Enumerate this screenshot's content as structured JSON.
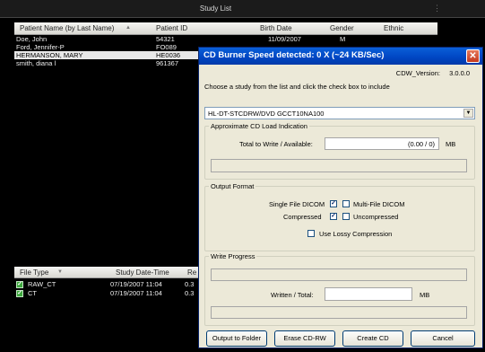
{
  "study_list": {
    "title": "Study List",
    "columns": [
      "Patient Name (by Last Name)",
      "Patient ID",
      "Birth Date",
      "Gender",
      "Ethnic"
    ],
    "rows": [
      {
        "name": "Doe, John",
        "id": "54321",
        "birth": "11/09/2007",
        "gender": "M",
        "selected": false
      },
      {
        "name": "Ford, Jennifer-P",
        "id": "FO089",
        "birth": "",
        "gender": "",
        "selected": false
      },
      {
        "name": "HERMANSON, MARY",
        "id": "HE0036",
        "birth": "",
        "gender": "",
        "selected": true
      },
      {
        "name": "smith, diana l",
        "id": "961367",
        "birth": "",
        "gender": "",
        "selected": false
      }
    ]
  },
  "file_list": {
    "columns": [
      "File Type",
      "Study Date-Time",
      "Re"
    ],
    "rows": [
      {
        "type": "RAW_CT",
        "datetime": "07/19/2007 11:04",
        "extra": "0.3",
        "checked": true
      },
      {
        "type": "CT",
        "datetime": "07/19/2007 11:04",
        "extra": "0.3",
        "checked": true
      }
    ]
  },
  "dialog": {
    "title": "CD Burner Speed detected: 0 X (~24 KB/Sec)",
    "version_label": "CDW_Version:",
    "version_value": "3.0.0.0",
    "instruction": "Choose a study from the list and click the check box to include",
    "drive": "HL-DT-STCDRW/DVD GCCT10NA100",
    "load": {
      "legend": "Approximate CD Load Indication",
      "label": "Total to Write / Available:",
      "value": "(0.00 / 0)",
      "unit": "MB",
      "progress": 0
    },
    "format": {
      "legend": "Output Format",
      "single_file": {
        "label": "Single File DICOM",
        "checked": true
      },
      "multi_file": {
        "label": "Multi-File DICOM",
        "checked": false
      },
      "compressed": {
        "label": "Compressed",
        "checked": true
      },
      "uncompressed": {
        "label": "Uncompressed",
        "checked": false
      },
      "lossy": {
        "label": "Use Lossy Compression",
        "checked": false
      }
    },
    "progress": {
      "legend": "Write Progress",
      "label": "Written / Total:",
      "value": "",
      "unit": "MB",
      "progress": 0
    },
    "buttons": {
      "output_folder": "Output to Folder",
      "erase": "Erase CD-RW",
      "create": "Create CD",
      "cancel": "Cancel"
    }
  }
}
